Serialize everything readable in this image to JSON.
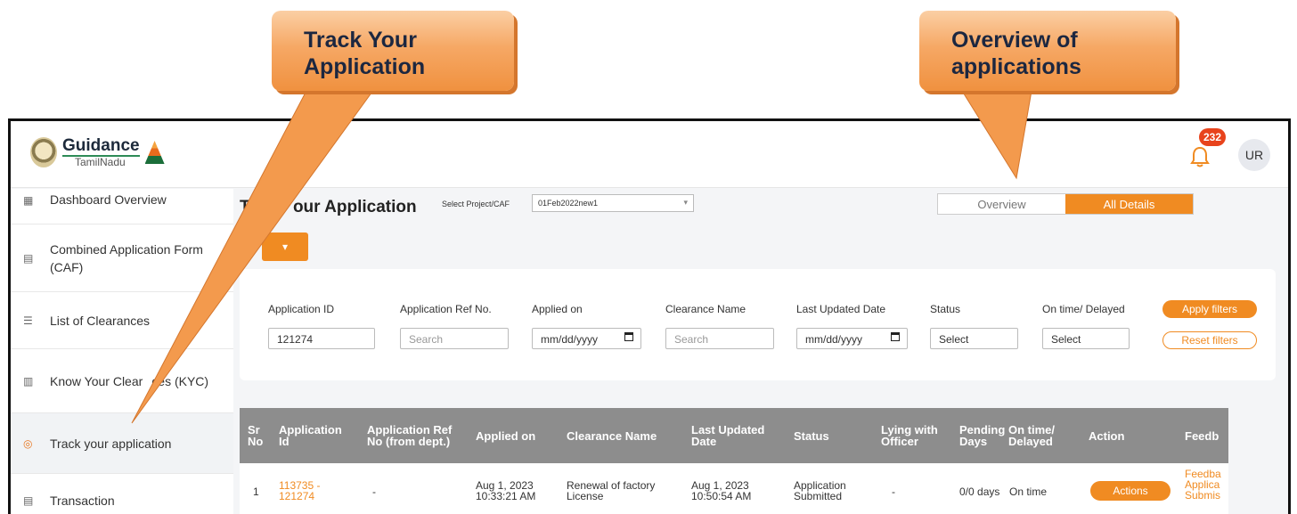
{
  "callouts": {
    "track": {
      "line1": "Track Your",
      "line2": "Application"
    },
    "overview": {
      "line1": "Overview of",
      "line2": "applications"
    }
  },
  "header": {
    "logo_main": "Guidance",
    "logo_sub": "TamilNadu",
    "notification_count": "232",
    "avatar_initials": "UR"
  },
  "sidebar": {
    "items": [
      {
        "label": "Dashboard Overview",
        "icon": "dashboard-icon"
      },
      {
        "label": "Combined Application Form",
        "label2": "(CAF)",
        "icon": "document-icon"
      },
      {
        "label": "List of Clearances",
        "icon": "list-icon"
      },
      {
        "label": "Know Your Clear",
        "label_tail": "ces (KYC)",
        "icon": "book-icon"
      },
      {
        "label": "Track your application",
        "icon": "location-pin-icon"
      },
      {
        "label": "Transaction",
        "icon": "transaction-icon"
      }
    ]
  },
  "main": {
    "title_left": "Tr",
    "title_right": "our Application",
    "project_label": "Select Project/CAF",
    "project_value": "01Feb2022new1",
    "tabs": [
      {
        "label": "Overview"
      },
      {
        "label": "All Details"
      }
    ],
    "filters": {
      "labels": [
        "Application ID",
        "Application Ref No.",
        "Applied on",
        "Clearance Name",
        "Last Updated Date",
        "Status",
        "On time/ Delayed"
      ],
      "values": {
        "application_id": "121274",
        "ref_placeholder": "Search",
        "applied_on": "mm/dd/yyyy",
        "clearance_placeholder": "Search",
        "last_updated": "mm/dd/yyyy",
        "status": "Select",
        "ontime": "Select"
      },
      "apply_label": "Apply filters",
      "reset_label": "Reset filters"
    },
    "table": {
      "headers": [
        [
          "Sr",
          "No"
        ],
        [
          "Application",
          "Id"
        ],
        [
          "Application Ref",
          "No (from dept.)"
        ],
        [
          "Applied on",
          ""
        ],
        [
          "Clearance Name",
          ""
        ],
        [
          "Last Updated",
          "Date"
        ],
        [
          "Status",
          ""
        ],
        [
          "Lying with",
          "Officer"
        ],
        [
          "Pending",
          "Days"
        ],
        [
          "On time/",
          "Delayed"
        ],
        [
          "Action",
          ""
        ],
        [
          "Feedb",
          ""
        ]
      ],
      "rows": [
        {
          "sr": "1",
          "app_id_1": "113735 -",
          "app_id_2": "121274",
          "ref": "-",
          "applied_1": "Aug 1, 2023",
          "applied_2": "10:33:21 AM",
          "clearance_1": "Renewal of factory",
          "clearance_2": "License",
          "updated_1": "Aug 1, 2023",
          "updated_2": "10:50:54 AM",
          "status_1": "Application",
          "status_2": "Submitted",
          "officer": "-",
          "pending": "0/0 days",
          "ontime": "On time",
          "action": "Actions",
          "feedback_1": "Feedba",
          "feedback_2": "Applica",
          "feedback_3": "Submis"
        }
      ]
    }
  }
}
